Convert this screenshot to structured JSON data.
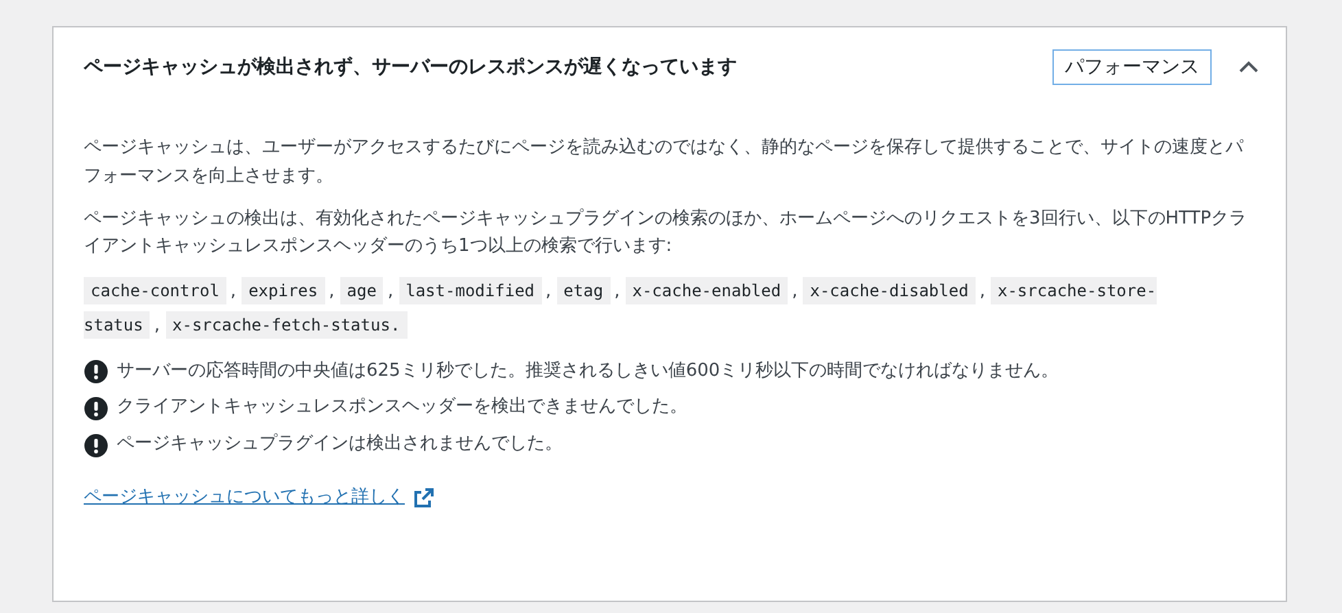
{
  "panel": {
    "title": "ページキャッシュが検出されず、サーバーのレスポンスが遅くなっています",
    "badge": "パフォーマンス",
    "expanded": true
  },
  "paragraphs": [
    "ページキャッシュは、ユーザーがアクセスするたびにページを読み込むのではなく、静的なページを保存して提供することで、サイトの速度とパフォーマンスを向上させます。",
    "ページキャッシュの検出は、有効化されたページキャッシュプラグインの検索のほか、ホームページへのリクエストを3回行い、以下のHTTPクライアントキャッシュレスポンスヘッダーのうち1つ以上の検索で行います:"
  ],
  "codes": [
    {
      "text": "cache-control",
      "separator": ","
    },
    {
      "text": "expires",
      "separator": ","
    },
    {
      "text": "age",
      "separator": ","
    },
    {
      "text": "last-modified",
      "separator": ","
    },
    {
      "text": "etag",
      "separator": ","
    },
    {
      "text": "x-cache-enabled",
      "separator": ","
    },
    {
      "text": "x-cache-disabled",
      "separator": ","
    },
    {
      "text": "x-srcache-store-status",
      "separator": ","
    },
    {
      "text": "x-srcache-fetch-status."
    }
  ],
  "warnings": [
    "サーバーの応答時間の中央値は625ミリ秒でした。推奨されるしきい値600ミリ秒以下の時間でなければなりません。",
    "クライアントキャッシュレスポンスヘッダーを検出できませんでした。",
    "ページキャッシュプラグインは検出されませんでした。"
  ],
  "link": "ページキャッシュについてもっと詳しく"
}
